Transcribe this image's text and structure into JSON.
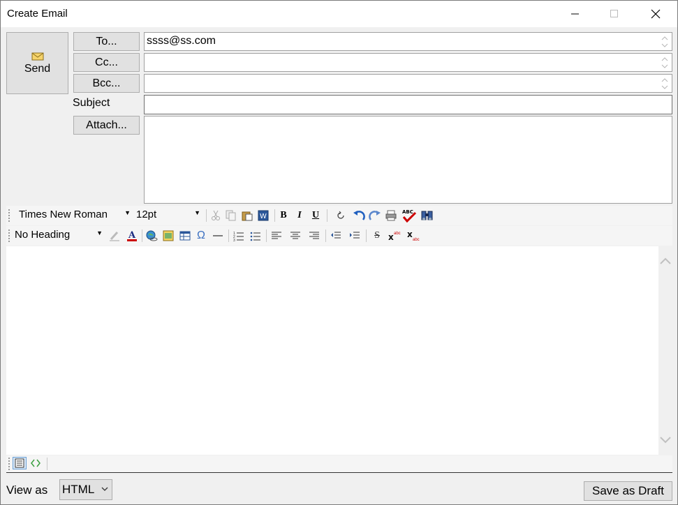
{
  "window": {
    "title": "Create Email"
  },
  "send": {
    "label": "Send"
  },
  "recipients": {
    "to_label": "To...",
    "cc_label": "Cc...",
    "bcc_label": "Bcc...",
    "to_value": "ssss@ss.com",
    "cc_value": "",
    "bcc_value": ""
  },
  "subject": {
    "label": "Subject",
    "value": ""
  },
  "attach": {
    "label": "Attach..."
  },
  "toolbar1": {
    "font": "Times New Roman",
    "size": "12pt",
    "icons": [
      "cut-icon",
      "copy-icon",
      "paste-icon",
      "paste-word-icon",
      "bold-icon",
      "italic-icon",
      "underline-icon",
      "refresh-icon",
      "undo-icon",
      "redo-icon",
      "print-icon",
      "spellcheck-icon",
      "find-icon"
    ],
    "bold_glyph": "B",
    "italic_glyph": "I",
    "underline_glyph": "U",
    "spell_glyph": "ABC"
  },
  "toolbar2": {
    "heading": "No Heading",
    "icons": [
      "highlight-icon",
      "font-color-icon",
      "hyperlink-icon",
      "image-icon",
      "table-icon",
      "special-char-icon",
      "horizontal-rule-icon",
      "numbered-list-icon",
      "bullet-list-icon",
      "align-left-icon",
      "align-center-icon",
      "align-right-icon",
      "outdent-icon",
      "indent-icon",
      "strikethrough-icon",
      "superscript-icon",
      "subscript-icon"
    ],
    "font_color_glyph": "A",
    "omega_glyph": "Ω",
    "strike_glyph": "S"
  },
  "bottom": {
    "view_as_label": "View as",
    "view_as_value": "HTML",
    "save_draft_label": "Save as Draft"
  },
  "colors": {
    "accent_blue": "#1f5fbf",
    "red": "#cc0000"
  }
}
